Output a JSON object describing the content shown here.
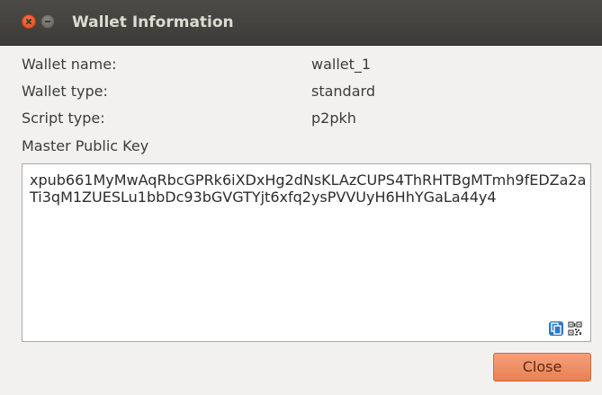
{
  "window": {
    "title": "Wallet Information"
  },
  "fields": [
    {
      "label": "Wallet name:",
      "value": "wallet_1"
    },
    {
      "label": "Wallet type:",
      "value": "standard"
    },
    {
      "label": "Script type:",
      "value": "p2pkh"
    }
  ],
  "master_key": {
    "label": "Master Public Key",
    "value": "xpub661MyMwAqRbcGPRk6iXDxHg2dNsKLAzCUPS4ThRHTBgMTmh9fEDZa2aTi3qM1ZUESLu1bbDc93bGVGTYjt6xfq2ysPVVUyH6HhYGaLa44y4",
    "icons": [
      "copy-icon",
      "qr-code-icon"
    ]
  },
  "buttons": {
    "close_label": "Close"
  },
  "colors": {
    "titlebar": "#3c3b37",
    "window_close": "#dd4814",
    "button_accent": "#ea8052",
    "copy_icon": "#2a79c8"
  }
}
